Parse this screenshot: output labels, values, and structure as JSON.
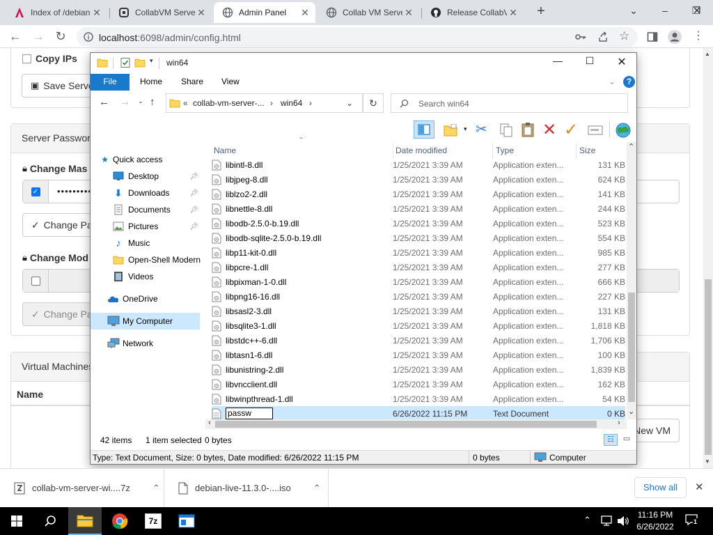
{
  "browser": {
    "tabs": [
      {
        "title": "Index of /debian-",
        "icon": "debian-icon",
        "active": false
      },
      {
        "title": "CollabVM Server",
        "icon": "collabvm-icon",
        "active": false
      },
      {
        "title": "Admin Panel",
        "icon": "globe-icon",
        "active": true
      },
      {
        "title": "Collab VM Server",
        "icon": "globe-icon",
        "active": false
      },
      {
        "title": "Release CollabVM",
        "icon": "github-icon",
        "active": false
      }
    ],
    "url_host": "localhost",
    "url_rest": ":6098/admin/config.html"
  },
  "page": {
    "copy_ips_label": "Copy IPs",
    "save_server_label": "Save Server",
    "server_password_heading": "Server Password",
    "change_master_label": "Change Mas",
    "password_value": "••••••••••",
    "change_password_button": "Change Pa",
    "change_mod_label": "Change Mod",
    "change_mod_button": "Change Pa",
    "virtual_machines_heading": "Virtual Machines",
    "name_column": "Name",
    "new_vm_button": "New VM"
  },
  "explorer": {
    "title": "win64",
    "ribbon_tabs": [
      "File",
      "Home",
      "Share",
      "View"
    ],
    "breadcrumb": [
      "collab-vm-server-...",
      "win64"
    ],
    "search_placeholder": "Search win64",
    "nav": [
      {
        "label": "Quick access",
        "icon": "star-icon",
        "pinned": false,
        "indent": 1
      },
      {
        "label": "Desktop",
        "icon": "desktop-icon",
        "pinned": true,
        "indent": 2
      },
      {
        "label": "Downloads",
        "icon": "download-icon",
        "pinned": true,
        "indent": 2
      },
      {
        "label": "Documents",
        "icon": "documents-icon",
        "pinned": true,
        "indent": 2
      },
      {
        "label": "Pictures",
        "icon": "pictures-icon",
        "pinned": true,
        "indent": 2
      },
      {
        "label": "Music",
        "icon": "music-icon",
        "pinned": false,
        "indent": 2
      },
      {
        "label": "Open-Shell Modern",
        "icon": "folder-icon",
        "pinned": false,
        "indent": 2
      },
      {
        "label": "Videos",
        "icon": "videos-icon",
        "pinned": false,
        "indent": 2
      },
      {
        "label": "OneDrive",
        "icon": "cloud-icon",
        "pinned": false,
        "indent": 1
      },
      {
        "label": "My Computer",
        "icon": "computer-icon",
        "pinned": false,
        "indent": 1
      },
      {
        "label": "Network",
        "icon": "network-icon",
        "pinned": false,
        "indent": 1
      }
    ],
    "columns": [
      "Name",
      "Date modified",
      "Type",
      "Size"
    ],
    "files": [
      {
        "name": "libintl-8.dll",
        "date": "1/25/2021 3:39 AM",
        "type": "Application exten...",
        "size": "131 KB"
      },
      {
        "name": "libjpeg-8.dll",
        "date": "1/25/2021 3:39 AM",
        "type": "Application exten...",
        "size": "624 KB"
      },
      {
        "name": "liblzo2-2.dll",
        "date": "1/25/2021 3:39 AM",
        "type": "Application exten...",
        "size": "141 KB"
      },
      {
        "name": "libnettle-8.dll",
        "date": "1/25/2021 3:39 AM",
        "type": "Application exten...",
        "size": "244 KB"
      },
      {
        "name": "libodb-2.5.0-b.19.dll",
        "date": "1/25/2021 3:39 AM",
        "type": "Application exten...",
        "size": "523 KB"
      },
      {
        "name": "libodb-sqlite-2.5.0-b.19.dll",
        "date": "1/25/2021 3:39 AM",
        "type": "Application exten...",
        "size": "554 KB"
      },
      {
        "name": "libp11-kit-0.dll",
        "date": "1/25/2021 3:39 AM",
        "type": "Application exten...",
        "size": "985 KB"
      },
      {
        "name": "libpcre-1.dll",
        "date": "1/25/2021 3:39 AM",
        "type": "Application exten...",
        "size": "277 KB"
      },
      {
        "name": "libpixman-1-0.dll",
        "date": "1/25/2021 3:39 AM",
        "type": "Application exten...",
        "size": "666 KB"
      },
      {
        "name": "libpng16-16.dll",
        "date": "1/25/2021 3:39 AM",
        "type": "Application exten...",
        "size": "227 KB"
      },
      {
        "name": "libsasl2-3.dll",
        "date": "1/25/2021 3:39 AM",
        "type": "Application exten...",
        "size": "131 KB"
      },
      {
        "name": "libsqlite3-1.dll",
        "date": "1/25/2021 3:39 AM",
        "type": "Application exten...",
        "size": "1,818 KB"
      },
      {
        "name": "libstdc++-6.dll",
        "date": "1/25/2021 3:39 AM",
        "type": "Application exten...",
        "size": "1,706 KB"
      },
      {
        "name": "libtasn1-6.dll",
        "date": "1/25/2021 3:39 AM",
        "type": "Application exten...",
        "size": "100 KB"
      },
      {
        "name": "libunistring-2.dll",
        "date": "1/25/2021 3:39 AM",
        "type": "Application exten...",
        "size": "1,839 KB"
      },
      {
        "name": "libvncclient.dll",
        "date": "1/25/2021 3:39 AM",
        "type": "Application exten...",
        "size": "162 KB"
      },
      {
        "name": "libwinpthread-1.dll",
        "date": "1/25/2021 3:39 AM",
        "type": "Application exten...",
        "size": "54 KB"
      }
    ],
    "renaming_file": {
      "name": "passw",
      "date": "6/26/2022 11:15 PM",
      "type": "Text Document",
      "size": "0 KB"
    },
    "status_items": "42 items",
    "status_selected": "1 item selected",
    "status_bytes": "0 bytes",
    "detail_text": "Type: Text Document, Size: 0 bytes, Date modified: 6/26/2022 11:15 PM",
    "detail_size": "0 bytes",
    "detail_location": "Computer"
  },
  "downloads": [
    {
      "name": "collab-vm-server-wi....7z",
      "icon": "archive-icon"
    },
    {
      "name": "debian-live-11.3.0-....iso",
      "icon": "file-icon"
    }
  ],
  "show_all_label": "Show all",
  "taskbar": {
    "time": "11:16 PM",
    "date": "6/26/2022",
    "notification_count": "1"
  }
}
